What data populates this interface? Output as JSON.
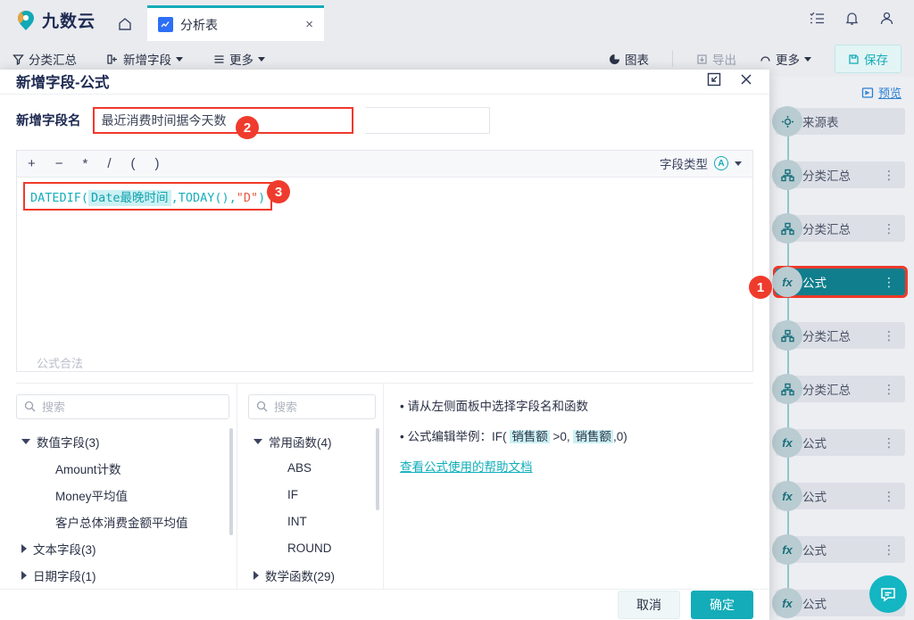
{
  "header": {
    "brand": "九数云",
    "home_icon": "home-icon",
    "tab": {
      "label": "分析表",
      "icon": "chart-tab-icon",
      "close": "×"
    },
    "right_icons": [
      "tasks-icon",
      "bell-icon",
      "user-icon"
    ]
  },
  "toolbar": {
    "items": [
      {
        "label": "分类汇总",
        "icon": "summary-icon",
        "has_caret": false
      },
      {
        "label": "新增字段",
        "icon": "add-field-icon",
        "has_caret": true
      },
      {
        "label": "更多",
        "icon": "more-list-icon",
        "has_caret": true
      }
    ],
    "right_items": [
      {
        "label": "图表",
        "icon": "chart-icon",
        "muted": false
      },
      {
        "label": "导出",
        "icon": "export-icon",
        "muted": true
      },
      {
        "label": "更多",
        "icon": "more-icon",
        "has_caret": true
      }
    ],
    "save_label": "保存",
    "save_icon": "save-icon"
  },
  "sidebar": {
    "preview_label": "预览",
    "preview_icon": "preview-icon",
    "steps": [
      {
        "label": "来源表",
        "icon": "source-table-icon",
        "active": false,
        "has_menu": false
      },
      {
        "label": "分类汇总",
        "icon": "group-icon",
        "active": false,
        "has_menu": true
      },
      {
        "label": "分类汇总",
        "icon": "group-icon",
        "active": false,
        "has_menu": true
      },
      {
        "label": "公式",
        "icon": "fx-icon",
        "active": true,
        "has_menu": true
      },
      {
        "label": "分类汇总",
        "icon": "group-icon",
        "active": false,
        "has_menu": true
      },
      {
        "label": "分类汇总",
        "icon": "group-icon",
        "active": false,
        "has_menu": true
      },
      {
        "label": "公式",
        "icon": "fx-icon",
        "active": false,
        "has_menu": true
      },
      {
        "label": "公式",
        "icon": "fx-icon",
        "active": false,
        "has_menu": true
      },
      {
        "label": "公式",
        "icon": "fx-icon",
        "active": false,
        "has_menu": true
      },
      {
        "label": "公式",
        "icon": "fx-icon",
        "active": false,
        "has_menu": true
      }
    ],
    "chat_icon": "chat-bubble-icon"
  },
  "annotations": [
    {
      "number": "1",
      "target": "sidebar-step-formula"
    },
    {
      "number": "2",
      "target": "field-name-input"
    },
    {
      "number": "3",
      "target": "formula-expression"
    }
  ],
  "modal": {
    "title": "新增字段-公式",
    "expand_icon": "expand-icon",
    "close_icon": "close-icon",
    "field_name": {
      "label": "新增字段名",
      "value": "最近消费时间据今天数"
    },
    "formula_toolbar": {
      "operators": [
        "+",
        "−",
        "*",
        "/",
        "(",
        ")"
      ],
      "field_type_label": "字段类型",
      "field_type_icon": "circled-a-icon",
      "caret": "▾"
    },
    "formula": {
      "func": "DATEDIF",
      "open": "(",
      "field_token": "Date最晚时间",
      "comma1": ",",
      "today": "TODAY()",
      "comma2": ",",
      "string_arg": "\"D\"",
      "close": ")"
    },
    "validity_text": "公式合法",
    "fields_panel": {
      "search_placeholder": "搜索",
      "search_icon": "search-icon",
      "tree": [
        {
          "label": "数值字段(3)",
          "expanded": true,
          "level": 0
        },
        {
          "label": "Amount计数",
          "level": 1
        },
        {
          "label": "Money平均值",
          "level": 1
        },
        {
          "label": "客户总体消费金额平均值",
          "level": 1
        },
        {
          "label": "文本字段(3)",
          "expanded": false,
          "level": 0
        },
        {
          "label": "日期字段(1)",
          "expanded": false,
          "level": 0
        }
      ]
    },
    "functions_panel": {
      "search_placeholder": "搜索",
      "search_icon": "search-icon",
      "tree": [
        {
          "label": "常用函数(4)",
          "expanded": true,
          "level": 0
        },
        {
          "label": "ABS",
          "level": 1
        },
        {
          "label": "IF",
          "level": 1
        },
        {
          "label": "INT",
          "level": 1
        },
        {
          "label": "ROUND",
          "level": 1
        },
        {
          "label": "数学函数(29)",
          "expanded": false,
          "level": 0
        }
      ]
    },
    "help_panel": {
      "line1": "• 请从左侧面板中选择字段名和函数",
      "line2_prefix": "• 公式编辑举例：",
      "line2_func": "IF(",
      "line2_tok1": "销售额",
      "line2_mid": ">0,",
      "line2_tok2": "销售额",
      "line2_suffix": ",0)",
      "link": "查看公式使用的帮助文档"
    },
    "footer": {
      "cancel": "取消",
      "confirm": "确定"
    }
  },
  "colors": {
    "accent": "#13acb8",
    "annotation": "#f0392b",
    "brand_dark": "#1e2a52",
    "link": "#2a7fd4"
  }
}
